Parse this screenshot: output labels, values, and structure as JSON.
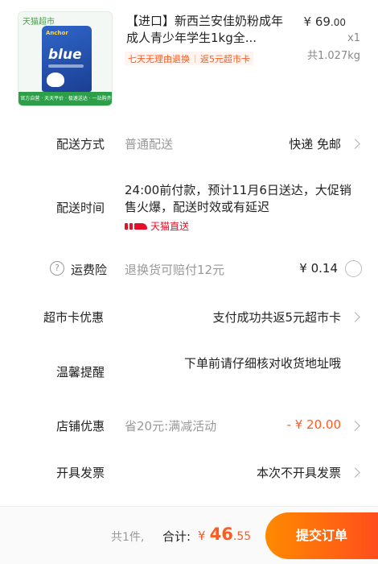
{
  "product": {
    "thumb_brand": "天猫超市",
    "thumb_logo": "Anchor",
    "thumb_word": "blue",
    "thumb_strip": "官方自营 · 天天平价 · 极速送达 · 一站购齐",
    "title": "【进口】新西兰安佳奶粉成年成人青少年学生1kg全...",
    "price_symbol": "¥",
    "price_int": "69",
    "price_dec": ".00",
    "quantity": "x1",
    "weight": "共1.027kg",
    "tags": [
      "七天无理由退换",
      "返5元超市卡"
    ]
  },
  "delivery_method": {
    "label": "配送方式",
    "placeholder": "普通配送",
    "value": "快递 免邮"
  },
  "delivery_time": {
    "label": "配送时间",
    "text": "24:00前付款，预计11月6日送达，大促销售火爆，配送时效或有延迟",
    "tmall_tag": "天猫直送"
  },
  "shipping_insurance": {
    "help_glyph": "?",
    "label": "运费险",
    "desc": "退换货可赔付12元",
    "price": "¥ 0.14"
  },
  "supermarket_card": {
    "label": "超市卡优惠",
    "value": "支付成功共返5元超市卡"
  },
  "reminder": {
    "label": "温馨提醒",
    "text": "下单前请仔细核对收货地址哦"
  },
  "store_discount": {
    "label": "店铺优惠",
    "desc": "省20元:满减活动",
    "value": "- ¥ 20.00"
  },
  "invoice": {
    "label": "开具发票",
    "value": "本次不开具发票"
  },
  "footer": {
    "count": "共1件,",
    "total_label": "合计:",
    "total_symbol": "¥",
    "total_int": "46",
    "total_dec": ".55",
    "submit_label": "提交订单"
  },
  "colors": {
    "accent": "#ff5a1f",
    "tmall_red": "#e5102a",
    "submit_start": "#ff8a00",
    "submit_end": "#ff4e1c"
  }
}
